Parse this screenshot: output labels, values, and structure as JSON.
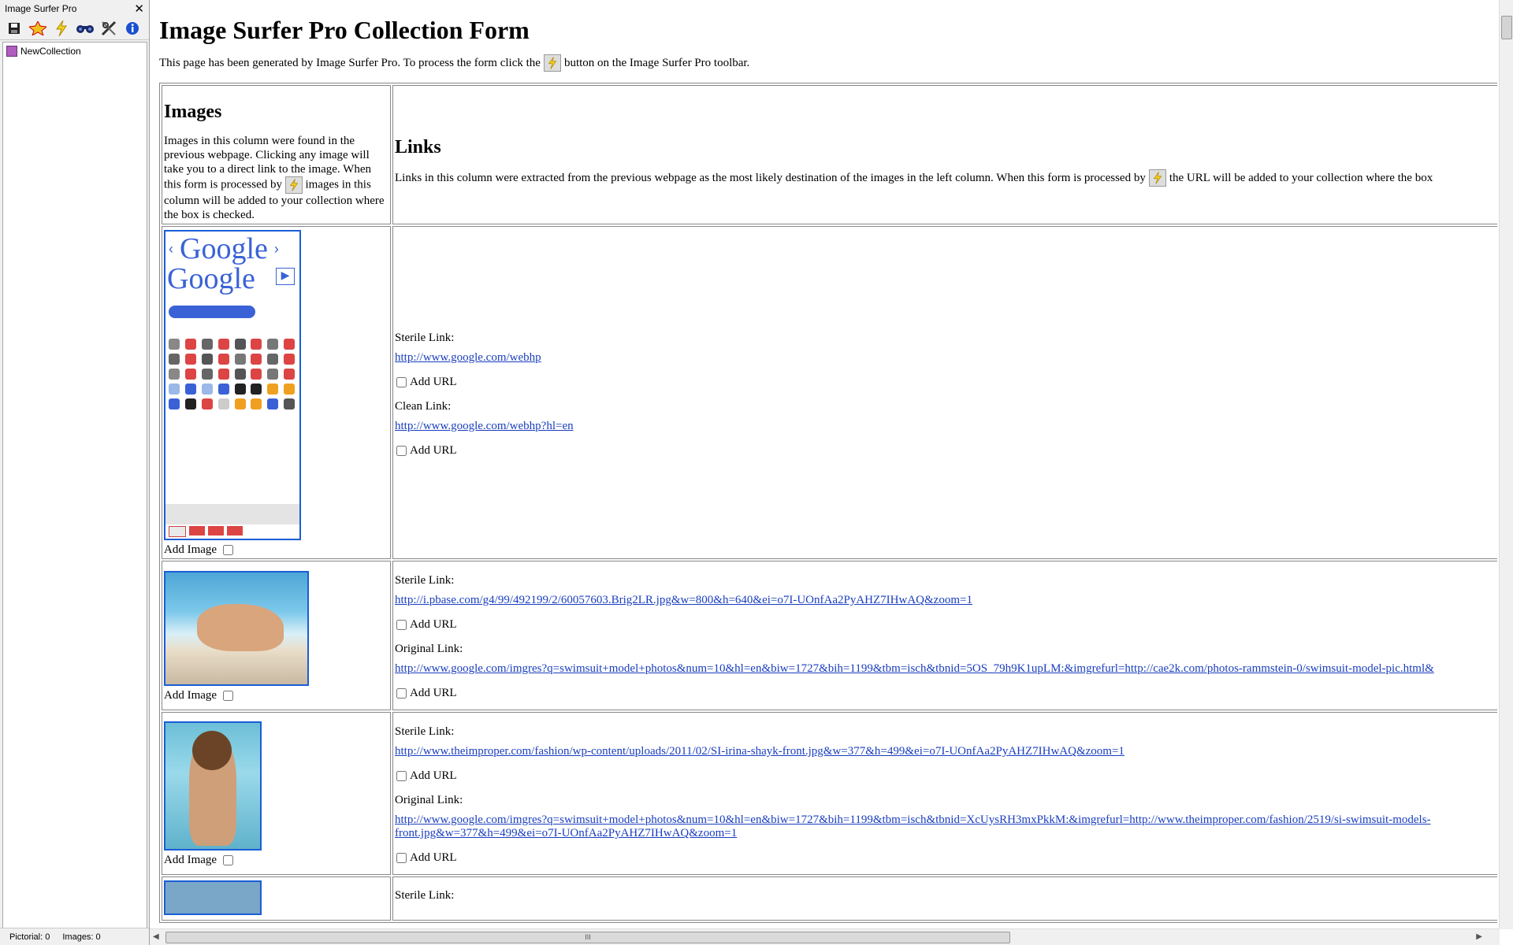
{
  "sidebar": {
    "title": "Image Surfer Pro",
    "toolbar_icons": [
      "save-icon",
      "brand-icon",
      "lightning-icon",
      "binoculars-icon",
      "tools-icon",
      "info-icon"
    ],
    "tree_items": [
      {
        "label": "NewCollection"
      }
    ],
    "status": {
      "pictorial": "Pictorial: 0",
      "images": "Images: 0"
    }
  },
  "page": {
    "title": "Image Surfer Pro Collection Form",
    "intro_before": "This page has been generated by Image Surfer Pro. To process the form click the",
    "intro_after": "button on the Image Surfer Pro toolbar.",
    "images_col": {
      "heading": "Images",
      "text_before": "Images in this column were found in the previous webpage. Clicking any image will take you to a direct link to the image. When this form is processed by",
      "text_after": "images in this column will be added to your collection where the box is checked."
    },
    "links_col": {
      "heading": "Links",
      "text_before": "Links in this column were extracted from the previous webpage as the most likely destination of the images in the left column. When this form is processed by",
      "text_after": "the URL will be added to your collection where the box"
    },
    "add_image_label": "Add Image",
    "add_url_label": "Add URL",
    "rows": [
      {
        "link1_label": "Sterile Link:",
        "link1_url": "http://www.google.com/webhp",
        "link2_label": "Clean Link:",
        "link2_url": "http://www.google.com/webhp?hl=en"
      },
      {
        "link1_label": "Sterile Link:",
        "link1_url": "http://i.pbase.com/g4/99/492199/2/60057603.Brig2LR.jpg&w=800&h=640&ei=o7I-UOnfAa2PyAHZ7IHwAQ&zoom=1",
        "link2_label": "Original Link:",
        "link2_url": "http://www.google.com/imgres?q=swimsuit+model+photos&num=10&hl=en&biw=1727&bih=1199&tbm=isch&tbnid=5OS_79h9K1upLM:&imgrefurl=http://cae2k.com/photos-rammstein-0/swimsuit-model-pic.html&"
      },
      {
        "link1_label": "Sterile Link:",
        "link1_url": "http://www.theimproper.com/fashion/wp-content/uploads/2011/02/SI-irina-shayk-front.jpg&w=377&h=499&ei=o7I-UOnfAa2PyAHZ7IHwAQ&zoom=1",
        "link2_label": "Original Link:",
        "link2_url": "http://www.google.com/imgres?q=swimsuit+model+photos&num=10&hl=en&biw=1727&bih=1199&tbm=isch&tbnid=XcUysRH3mxPkkM:&imgrefurl=http://www.theimproper.com/fashion/2519/si-swimsuit-models-",
        "link2_url_cont": "front.jpg&w=377&h=499&ei=o7I-UOnfAa2PyAHZ7IHwAQ&zoom=1"
      },
      {
        "link1_label": "Sterile Link:"
      }
    ],
    "sprite_logo": "Google",
    "hscroll_grip": "III"
  }
}
